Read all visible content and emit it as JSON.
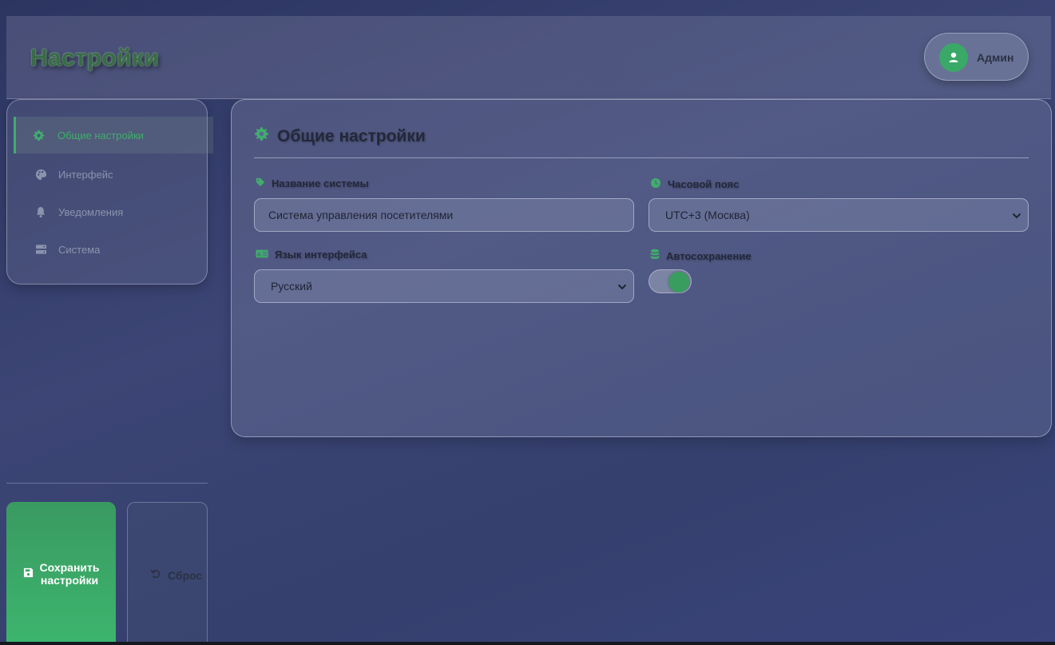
{
  "header": {
    "title": "Настройки",
    "user": {
      "name": "Админ",
      "avatar_icon": "user-icon"
    }
  },
  "sidebar": {
    "items": [
      {
        "label": "Общие настройки",
        "icon": "gear-icon",
        "active": true
      },
      {
        "label": "Интерфейс",
        "icon": "palette-icon",
        "active": false
      },
      {
        "label": "Уведомления",
        "icon": "bell-icon",
        "active": false
      },
      {
        "label": "Система",
        "icon": "server-icon",
        "active": false
      }
    ],
    "save_label_line1": "Сохранить",
    "save_label_line2": "настройки",
    "reset_label": "Сброс"
  },
  "panel": {
    "title": "Общие настройки",
    "system_name": {
      "label": "Название системы",
      "value": "Система управления посетителями"
    },
    "timezone": {
      "label": "Часовой пояс",
      "value": "UTC+3 (Москва)"
    },
    "language": {
      "label": "Язык интерфейса",
      "value": "Русский"
    },
    "autosave": {
      "label": "Автосохранение",
      "enabled": true
    }
  },
  "colors": {
    "accent": "#3fae6b",
    "background": "#35406e"
  }
}
